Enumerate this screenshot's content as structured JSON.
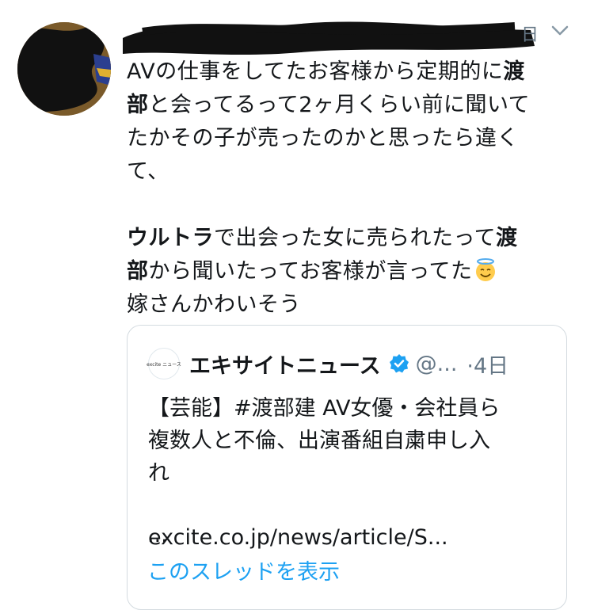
{
  "tweet": {
    "date_stub": "日",
    "lines": [
      [
        {
          "t": "AVの仕事をしてたお客様から定期的に",
          "b": false
        },
        {
          "t": "渡",
          "b": true
        }
      ],
      [
        {
          "t": "部",
          "b": true
        },
        {
          "t": "と会ってるって2ヶ月くらい前に聞いて",
          "b": false
        }
      ],
      [
        {
          "t": "たかその子が売ったのかと思ったら違く",
          "b": false
        }
      ],
      [
        {
          "t": "て、",
          "b": false
        }
      ],
      [],
      [
        {
          "t": "ウルトラ",
          "b": true
        },
        {
          "t": "で出会った女に売られたって",
          "b": false
        },
        {
          "t": "渡",
          "b": true
        }
      ],
      [
        {
          "t": "部",
          "b": true
        },
        {
          "t": "から聞いたってお客様が言ってた",
          "b": false
        },
        {
          "emoji": "smiling-face-with-halo"
        }
      ],
      [
        {
          "t": "嫁さんかわいそう",
          "b": false
        }
      ]
    ]
  },
  "quote": {
    "avatar_text": "excite ニュース",
    "name": "エキサイトニュース",
    "handle": "@...",
    "date": "·4日",
    "text_lines": [
      "【芸能】#渡部建 AV女優・会社員ら",
      "複数人と不倫、出演番組自粛申し入",
      "れ"
    ],
    "link": "excite.co.jp/news/article/S...",
    "ellipsis": "..."
  },
  "thread_link": "このスレッドを表示",
  "colors": {
    "accent": "#1da1f2",
    "secondary_text": "#657786",
    "border": "#d4dbe0"
  }
}
